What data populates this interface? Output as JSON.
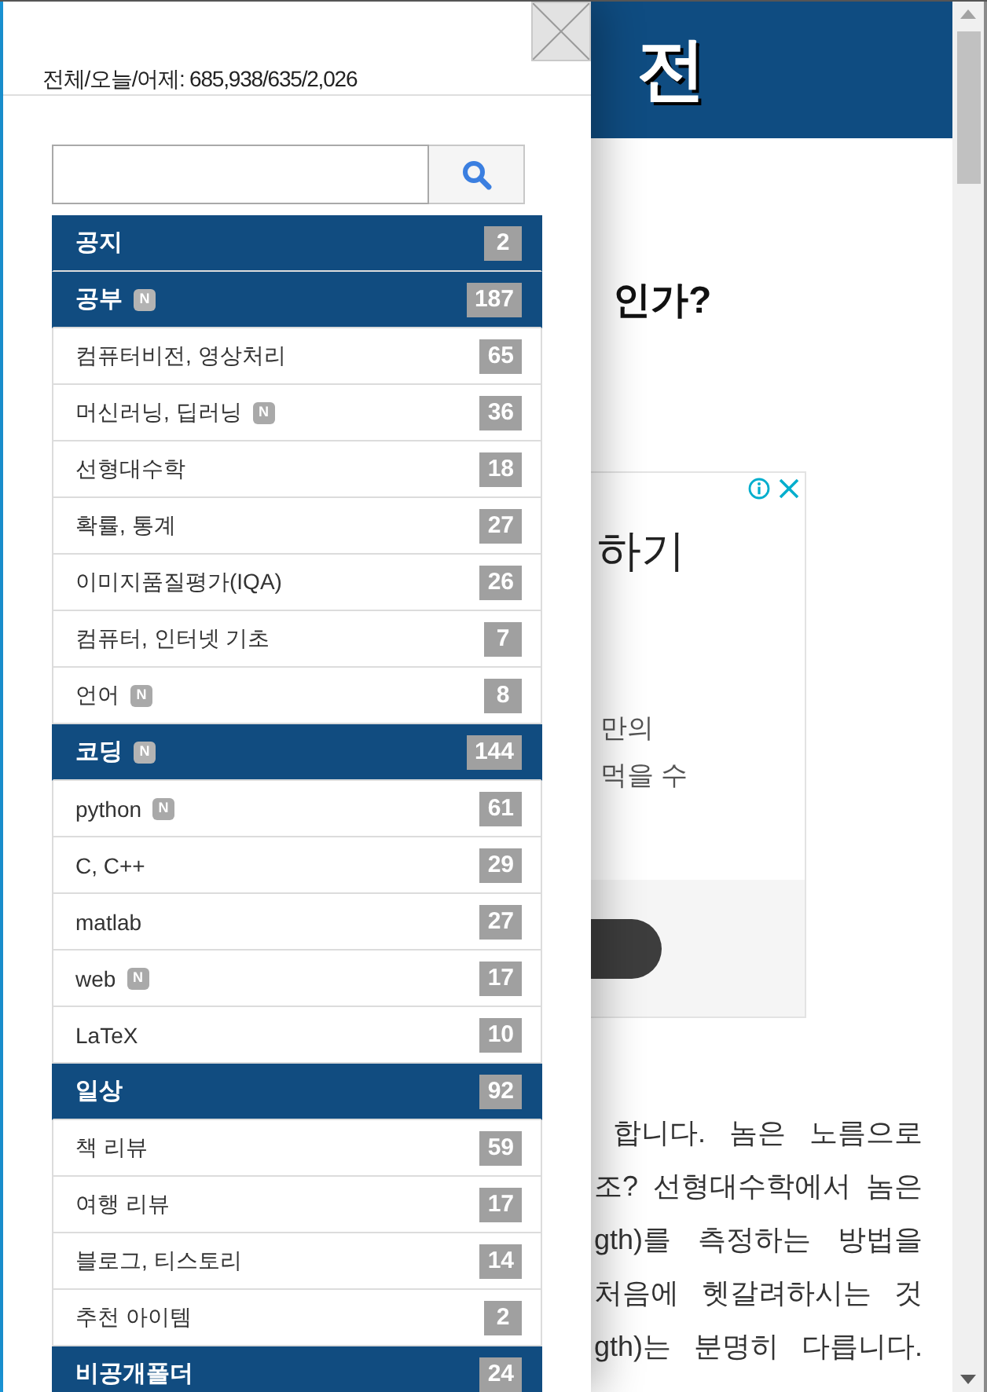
{
  "sidebar": {
    "visitor_stats": "전체/오늘/어제: 685,938/635/2,026",
    "categories": [
      {
        "label": "공지",
        "count": "2"
      },
      {
        "label": "공부",
        "badge": "N",
        "count": "187",
        "children": [
          {
            "label": "컴퓨터비전, 영상처리",
            "count": "65"
          },
          {
            "label": "머신러닝, 딥러닝",
            "badge": "N",
            "count": "36"
          },
          {
            "label": "선형대수학",
            "count": "18"
          },
          {
            "label": "확률, 통계",
            "count": "27"
          },
          {
            "label": "이미지품질평가(IQA)",
            "count": "26"
          },
          {
            "label": "컴퓨터, 인터넷 기초",
            "count": "7"
          },
          {
            "label": "언어",
            "badge": "N",
            "count": "8"
          }
        ]
      },
      {
        "label": "코딩",
        "badge": "N",
        "count": "144",
        "children": [
          {
            "label": "python",
            "badge": "N",
            "count": "61"
          },
          {
            "label": "C, C++",
            "count": "29"
          },
          {
            "label": "matlab",
            "count": "27"
          },
          {
            "label": "web",
            "badge": "N",
            "count": "17"
          },
          {
            "label": "LaTeX",
            "count": "10"
          }
        ]
      },
      {
        "label": "일상",
        "count": "92",
        "children": [
          {
            "label": "책 리뷰",
            "count": "59"
          },
          {
            "label": "여행 리뷰",
            "count": "17"
          },
          {
            "label": "블로그, 티스토리",
            "count": "14"
          },
          {
            "label": "추천 아이템",
            "count": "2"
          }
        ]
      },
      {
        "label": "비공개폴더",
        "count": "24"
      }
    ]
  },
  "page": {
    "banner_title": "전",
    "heading": "인가?",
    "ad": {
      "headline": "하기",
      "body_lines": [
        "만의",
        "먹을 수"
      ]
    },
    "text_lines": [
      "합니다. 놈은 노름으로",
      "조? 선형대수학에서 놈은",
      "gth)를 측정하는 방법을",
      "처음에 헷갈려하시는 것",
      "gth)는 분명히 다릅니다."
    ]
  }
}
